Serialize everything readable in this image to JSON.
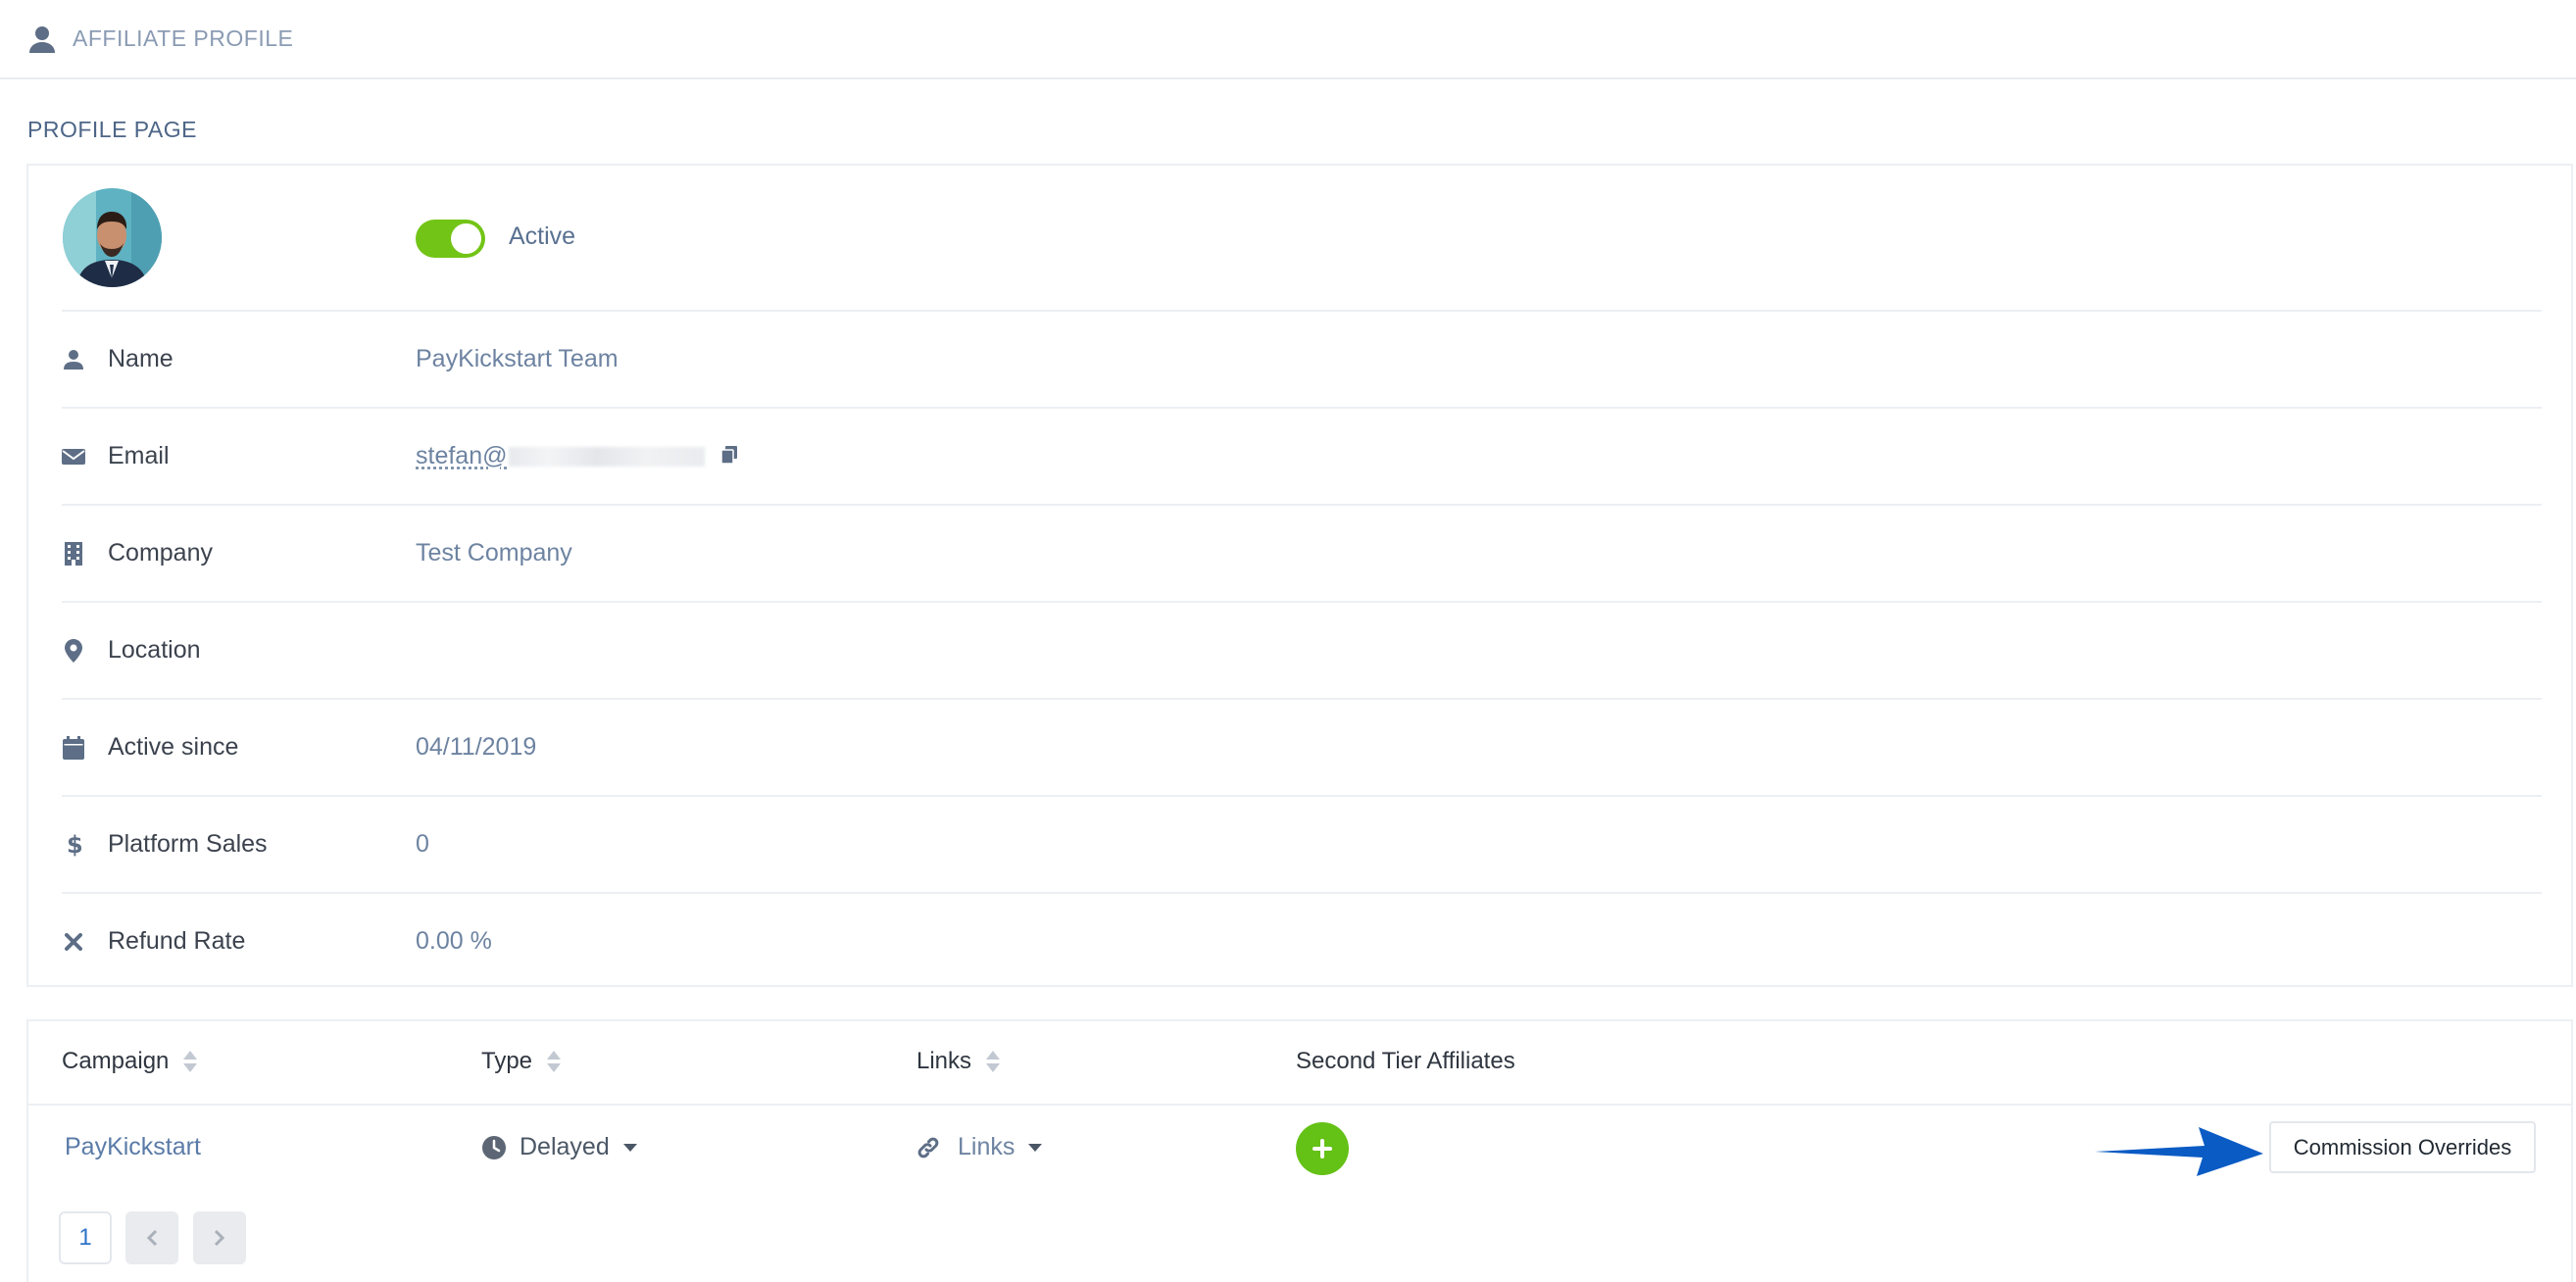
{
  "header": {
    "title": "AFFILIATE PROFILE",
    "icon": "user-icon"
  },
  "page": {
    "section_title": "PROFILE PAGE"
  },
  "profile": {
    "avatar_icon": "avatar",
    "status": {
      "label": "Active",
      "enabled": true,
      "color": "#72c416"
    },
    "fields": [
      {
        "icon": "user-icon",
        "label": "Name",
        "value": "PayKickstart Team"
      },
      {
        "icon": "envelope-icon",
        "label": "Email",
        "value": "stefan@"
      },
      {
        "icon": "building-icon",
        "label": "Company",
        "value": "Test Company"
      },
      {
        "icon": "map-marker-icon",
        "label": "Location",
        "value": ""
      },
      {
        "icon": "calendar-icon",
        "label": "Active since",
        "value": "04/11/2019"
      },
      {
        "icon": "dollar-icon",
        "label": "Platform Sales",
        "value": "0"
      },
      {
        "icon": "times-icon",
        "label": "Refund Rate",
        "value": "0.00 %"
      }
    ]
  },
  "table": {
    "columns": [
      {
        "label": "Campaign",
        "sortable": true
      },
      {
        "label": "Type",
        "sortable": true
      },
      {
        "label": "Links",
        "sortable": true
      },
      {
        "label": "Second Tier Affiliates",
        "sortable": false
      }
    ],
    "rows": [
      {
        "campaign": "PayKickstart",
        "type": "Delayed",
        "links": "Links",
        "add_icon": "plus-icon",
        "action": "Commission Overrides"
      }
    ],
    "pagination": {
      "current_page": "1"
    }
  },
  "colors": {
    "accent_green": "#64c116",
    "link_blue": "#5a7ba8",
    "arrow_blue": "#0a5bc4"
  }
}
